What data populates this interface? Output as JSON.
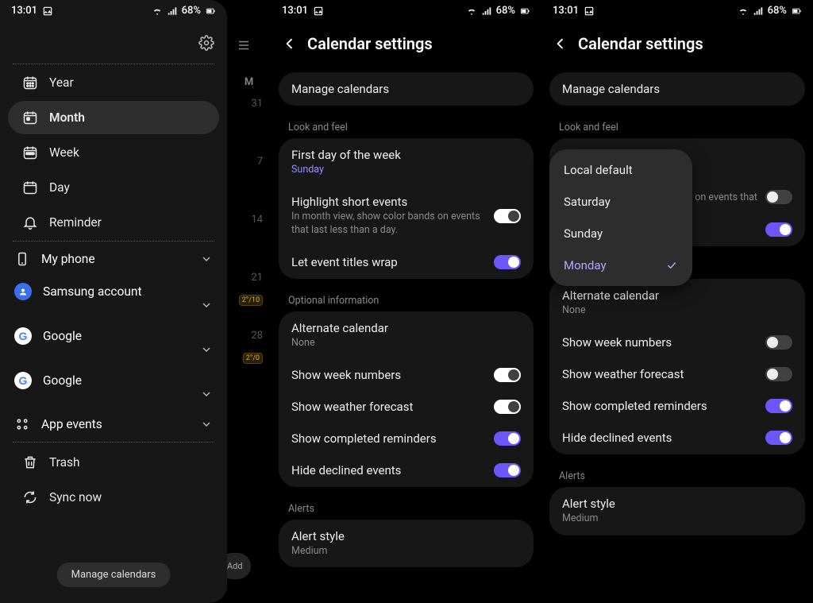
{
  "status": {
    "time": "13:01",
    "battery": "68%"
  },
  "panel1": {
    "nav": {
      "year": "Year",
      "month": "Month",
      "week": "Week",
      "day": "Day",
      "reminder": "Reminder"
    },
    "accounts": {
      "myphone": "My phone",
      "samsung": "Samsung account",
      "google1": "Google",
      "google2": "Google",
      "appevents": "App events"
    },
    "trash": "Trash",
    "syncnow": "Sync now",
    "manage_btn": "Manage calendars",
    "bg_letter": "M",
    "bg_days": [
      "31",
      "7",
      "14",
      "21",
      "28"
    ],
    "bg_add": "Add",
    "bg_weather1": "2°/10",
    "bg_weather2": "2°/0"
  },
  "settings": {
    "title": "Calendar settings",
    "manage": "Manage calendars",
    "look_feel": "Look and feel",
    "first_day": {
      "title": "First day of the week",
      "value": "Sunday"
    },
    "highlight": {
      "title": "Highlight short events",
      "sub": "In month view, show color bands on events that last less than a day."
    },
    "highlight_short_p3": "nds on events that",
    "wrap": "Let event titles wrap",
    "optional": "Optional information",
    "alt_cal": {
      "title": "Alternate calendar",
      "value": "None"
    },
    "week_num": "Show week numbers",
    "weather": "Show weather forecast",
    "completed": "Show completed reminders",
    "declined": "Hide declined events",
    "alerts": "Alerts",
    "alert_style": {
      "title": "Alert style",
      "value": "Medium"
    }
  },
  "popup": {
    "local": "Local default",
    "sat": "Saturday",
    "sun": "Sunday",
    "mon": "Monday"
  }
}
